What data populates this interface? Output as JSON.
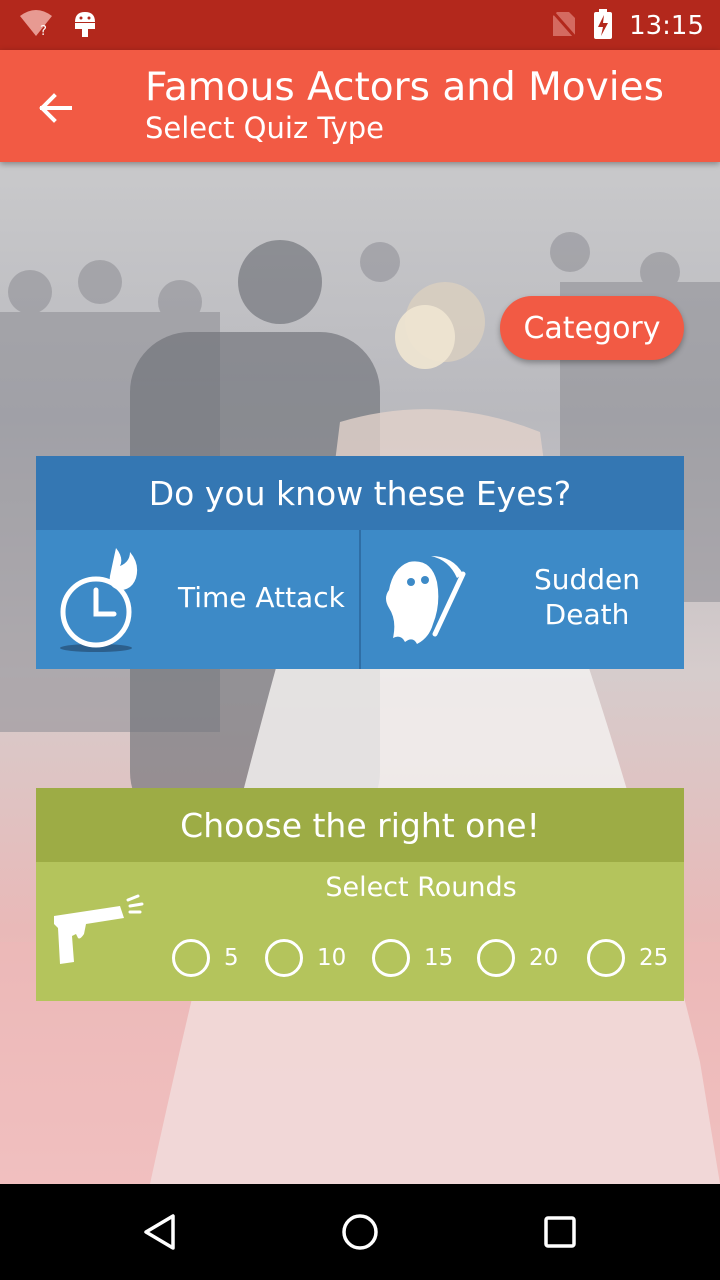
{
  "status_bar": {
    "time": "13:15",
    "icons": [
      "wifi-question-icon",
      "android-debug-icon",
      "no-sim-icon",
      "battery-charging-icon"
    ]
  },
  "app_bar": {
    "title": "Famous Actors and Movies",
    "subtitle": "Select Quiz Type",
    "back_icon": "arrow-back-icon"
  },
  "category_button": "Category",
  "eyes_card": {
    "title": "Do you know these Eyes?",
    "modes": [
      {
        "label": "Time Attack",
        "icon": "stopwatch-fire-icon"
      },
      {
        "label": "Sudden Death",
        "icon": "ghost-scythe-icon"
      }
    ]
  },
  "choose_card": {
    "title": "Choose the right one!",
    "rounds_label": "Select Rounds",
    "icon": "pistol-icon",
    "rounds": [
      "5",
      "10",
      "15",
      "20",
      "25"
    ]
  },
  "nav_bar": {
    "icons": [
      "back-triangle-icon",
      "home-circle-icon",
      "recents-square-icon"
    ]
  },
  "colors": {
    "status_bar": "#b3281c",
    "app_bar": "#f25a44",
    "blue_header": "#3477b3",
    "blue_body": "#3d8ac7",
    "green_header": "#9dac45",
    "green_body": "#b4c45c"
  }
}
